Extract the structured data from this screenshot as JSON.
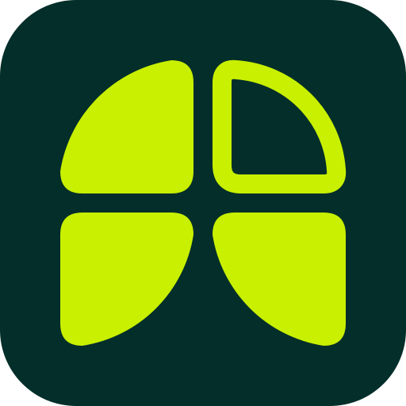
{
  "icon": {
    "name": "pie-chart-app-icon",
    "background_color": "#042E2A",
    "accent_color": "#C8F000"
  }
}
